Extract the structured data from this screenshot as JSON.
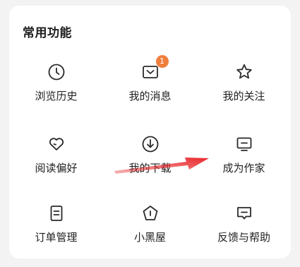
{
  "section": {
    "title": "常用功能"
  },
  "items": [
    {
      "label": "浏览历史",
      "icon": "clock-icon"
    },
    {
      "label": "我的消息",
      "icon": "message-inbox-icon",
      "badge": "1"
    },
    {
      "label": "我的关注",
      "icon": "star-icon"
    },
    {
      "label": "阅读偏好",
      "icon": "heart-icon"
    },
    {
      "label": "我的下载",
      "icon": "download-icon"
    },
    {
      "label": "成为作家",
      "icon": "monitor-icon"
    },
    {
      "label": "订单管理",
      "icon": "document-icon"
    },
    {
      "label": "小黑屋",
      "icon": "pentagon-alert-icon"
    },
    {
      "label": "反馈与帮助",
      "icon": "chat-help-icon"
    }
  ],
  "colors": {
    "badge": "#ef7e3c",
    "arrow": "#e8272b",
    "icon_stroke": "#2a2a2a"
  }
}
